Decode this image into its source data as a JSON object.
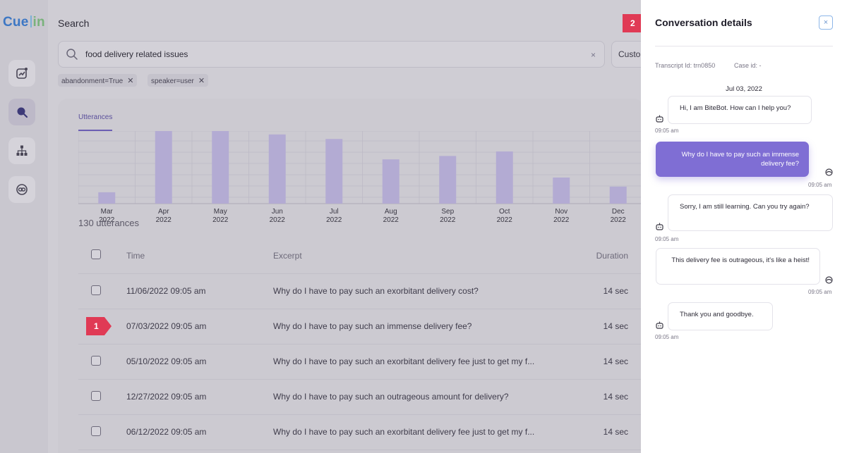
{
  "app": {
    "logo_cue": "Cue",
    "logo_in": "in",
    "page_title": "Search"
  },
  "rail": {
    "items": [
      {
        "name": "analytics-icon"
      },
      {
        "name": "search-icon",
        "active": true
      },
      {
        "name": "hierarchy-icon"
      },
      {
        "name": "link-icon"
      }
    ]
  },
  "search": {
    "query": "food delivery related issues",
    "clear_label": "×",
    "customize_label": "Custo"
  },
  "filters": [
    {
      "label": "abandonment=True",
      "remove": "✕"
    },
    {
      "label": "speaker=user",
      "remove": "✕"
    }
  ],
  "tab": {
    "label": "Utterances"
  },
  "chart_data": {
    "type": "bar",
    "categories": [
      "Mar\n2022",
      "Apr\n2022",
      "May\n2022",
      "Jun\n2022",
      "Jul\n2022",
      "Aug\n2022",
      "Sep\n2022",
      "Oct\n2022",
      "Nov\n2022",
      "Dec\n2022"
    ],
    "months": [
      "Mar",
      "Apr",
      "May",
      "Jun",
      "Jul",
      "Aug",
      "Sep",
      "Oct",
      "Nov",
      "Dec"
    ],
    "years": [
      "2022",
      "2022",
      "2022",
      "2022",
      "2022",
      "2022",
      "2022",
      "2022",
      "2022",
      "2022"
    ],
    "values": [
      10,
      64,
      64,
      61,
      57,
      39,
      42,
      46,
      23,
      15
    ],
    "ylim": [
      0,
      64
    ],
    "grid": true,
    "color": "#b3abd3"
  },
  "list": {
    "count_label": "130 utterances",
    "headers": {
      "time": "Time",
      "excerpt": "Excerpt",
      "duration": "Duration"
    },
    "rows": [
      {
        "time": "11/06/2022 09:05 am",
        "excerpt": "Why do I have to pay such an exorbitant delivery cost?",
        "duration": "14 sec"
      },
      {
        "time": "07/03/2022 09:05 am",
        "excerpt": "Why do I have to pay such an immense delivery fee?",
        "duration": "14 sec",
        "marked": true
      },
      {
        "time": "05/10/2022 09:05 am",
        "excerpt": "Why do I have to pay such an exorbitant delivery fee just to get my f...",
        "duration": "14 sec"
      },
      {
        "time": "12/27/2022 09:05 am",
        "excerpt": "Why do I have to pay such an outrageous amount for delivery?",
        "duration": "14 sec"
      },
      {
        "time": "06/12/2022 09:05 am",
        "excerpt": "Why do I have to pay such an exorbitant delivery fee just to get my f...",
        "duration": "14 sec"
      }
    ]
  },
  "markers": {
    "one": "1",
    "two": "2"
  },
  "panel": {
    "title": "Conversation details",
    "close_label": "×",
    "transcript": "Transcript Id: trn0850",
    "case": "Case id: -",
    "date": "Jul 03, 2022",
    "messages": [
      {
        "speaker": "bot",
        "text": "Hi, I am BiteBot. How can I help you?",
        "time": "09:05 am"
      },
      {
        "speaker": "user",
        "text": "Why do I have to pay such an immense delivery fee?",
        "time": "09:05 am"
      },
      {
        "speaker": "bot",
        "text": "Sorry, I am still learning. Can you try again?",
        "time": "09:05 am"
      },
      {
        "speaker": "customer",
        "text": "This delivery fee is outrageous, it's like a heist!",
        "time": "09:05 am"
      },
      {
        "speaker": "bot",
        "text": "Thank you and goodbye.",
        "time": "09:05 am"
      }
    ]
  },
  "colors": {
    "accent": "#7f6ed4",
    "marker": "#e03a55",
    "logo_blue": "#3d77c4",
    "logo_green": "#79b27b"
  }
}
